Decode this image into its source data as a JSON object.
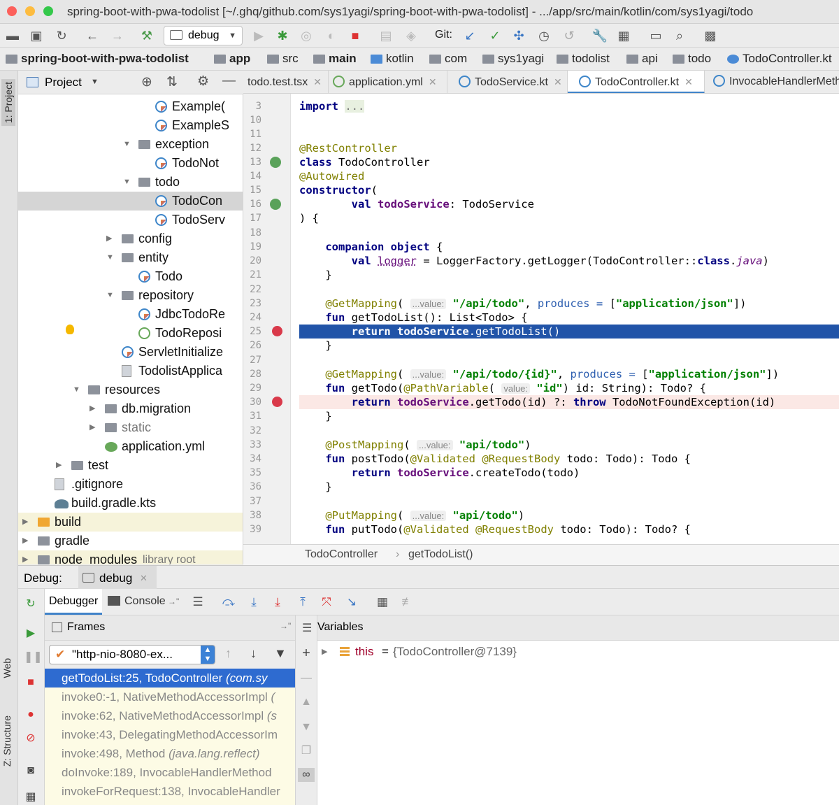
{
  "window": {
    "title": "spring-boot-with-pwa-todolist [~/.ghq/github.com/sys1yagi/spring-boot-with-pwa-todolist] - .../app/src/main/kotlin/com/sys1yagi/todo"
  },
  "toolbar": {
    "run_config": "debug",
    "git_label": "Git:"
  },
  "navbar": {
    "crumbs": [
      "spring-boot-with-pwa-todolist",
      "app",
      "src",
      "main",
      "kotlin",
      "com",
      "sys1yagi",
      "todolist",
      "api",
      "todo",
      "TodoController.kt"
    ]
  },
  "left_strip": {
    "project_tab": "1: Project",
    "web_tab": "Web",
    "structure_tab": "Z: Structure"
  },
  "project": {
    "header": "Project",
    "tree": [
      {
        "label": "Example(",
        "icon": "kotlin-class-icon",
        "indent": 222
      },
      {
        "label": "ExampleS",
        "icon": "kotlin-class-icon",
        "indent": 222
      },
      {
        "label": "exception",
        "icon": "folder-icon",
        "indent": 198,
        "arrow": "▼"
      },
      {
        "label": "TodoNot",
        "icon": "kotlin-class-icon",
        "indent": 222
      },
      {
        "label": "todo",
        "icon": "folder-icon",
        "indent": 198,
        "arrow": "▼"
      },
      {
        "label": "TodoCon",
        "icon": "kotlin-class-icon",
        "indent": 222,
        "selected": true
      },
      {
        "label": "TodoServ",
        "icon": "kotlin-class-icon",
        "indent": 222
      },
      {
        "label": "config",
        "icon": "folder-icon",
        "indent": 174,
        "arrow": "▶"
      },
      {
        "label": "entity",
        "icon": "folder-icon",
        "indent": 174,
        "arrow": "▼"
      },
      {
        "label": "Todo",
        "icon": "kotlin-class-icon",
        "indent": 198
      },
      {
        "label": "repository",
        "icon": "folder-icon",
        "indent": 174,
        "arrow": "▼"
      },
      {
        "label": "JdbcTodoRe",
        "icon": "kotlin-class-icon",
        "indent": 198
      },
      {
        "label": "TodoReposi",
        "icon": "kotlin-interface-icon",
        "indent": 198
      },
      {
        "label": "ServletInitialize",
        "icon": "kotlin-class-icon",
        "indent": 174
      },
      {
        "label": "TodolistApplica",
        "icon": "file-icon",
        "indent": 174
      },
      {
        "label": "resources",
        "icon": "folder-icon",
        "indent": 126,
        "arrow": "▼"
      },
      {
        "label": "db.migration",
        "icon": "folder-icon",
        "indent": 150,
        "arrow": "▶"
      },
      {
        "label": "static",
        "icon": "folder-icon",
        "indent": 150,
        "arrow": "▶",
        "gray": true
      },
      {
        "label": "application.yml",
        "icon": "yml-icon",
        "indent": 150
      },
      {
        "label": "test",
        "icon": "folder-icon",
        "indent": 102,
        "arrow": "▶"
      },
      {
        "label": ".gitignore",
        "icon": "file-icon",
        "indent": 78
      },
      {
        "label": "build.gradle.kts",
        "icon": "gradle-icon",
        "indent": 78
      },
      {
        "label": "build",
        "icon": "folder-orange-icon",
        "indent": 54,
        "arrow": "▶",
        "yellow": true
      },
      {
        "label": "gradle",
        "icon": "folder-icon",
        "indent": 54,
        "arrow": "▶"
      },
      {
        "label": "node_modules",
        "suffix": "library root",
        "icon": "folder-icon",
        "indent": 54,
        "arrow": "▶",
        "yellow": true
      }
    ]
  },
  "tabs": [
    {
      "label": "todo.test.tsx",
      "icon": "none"
    },
    {
      "label": "application.yml",
      "icon": "yml"
    },
    {
      "label": "TodoService.kt",
      "icon": "kt"
    },
    {
      "label": "TodoController.kt",
      "icon": "kt",
      "active": true
    },
    {
      "label": "InvocableHandlerMetho",
      "icon": "kt",
      "noclose": true
    }
  ],
  "editor": {
    "line_numbers": [
      "3",
      "10",
      "11",
      "12",
      "13",
      "14",
      "15",
      "16",
      "17",
      "18",
      "19",
      "20",
      "21",
      "22",
      "23",
      "24",
      "25",
      "26",
      "27",
      "28",
      "29",
      "30",
      "31",
      "32",
      "33",
      "34",
      "35",
      "36",
      "37",
      "38",
      "39"
    ],
    "breadcrumb": [
      "TodoController",
      "getTodoList()"
    ]
  },
  "debug": {
    "label": "Debug:",
    "session": "debug",
    "debugger_tab": "Debugger",
    "console_tab": "Console",
    "frames_header": "Frames",
    "variables_header": "Variables",
    "thread": "\"http-nio-8080-ex...",
    "frames": [
      {
        "text": "getTodoList:25, TodoController",
        "pkg": "(com.sy"
      },
      {
        "text": "invoke0:-1, NativeMethodAccessorImpl",
        "pkg": "("
      },
      {
        "text": "invoke:62, NativeMethodAccessorImpl",
        "pkg": "(s"
      },
      {
        "text": "invoke:43, DelegatingMethodAccessorIm",
        "pkg": ""
      },
      {
        "text": "invoke:498, Method",
        "pkg": "(java.lang.reflect)"
      },
      {
        "text": "doInvoke:189, InvocableHandlerMethod",
        "pkg": ""
      },
      {
        "text": "invokeForRequest:138, InvocableHandler",
        "pkg": ""
      }
    ],
    "variable": {
      "name": "this",
      "eq": "=",
      "value": "{TodoController@7139}"
    }
  }
}
